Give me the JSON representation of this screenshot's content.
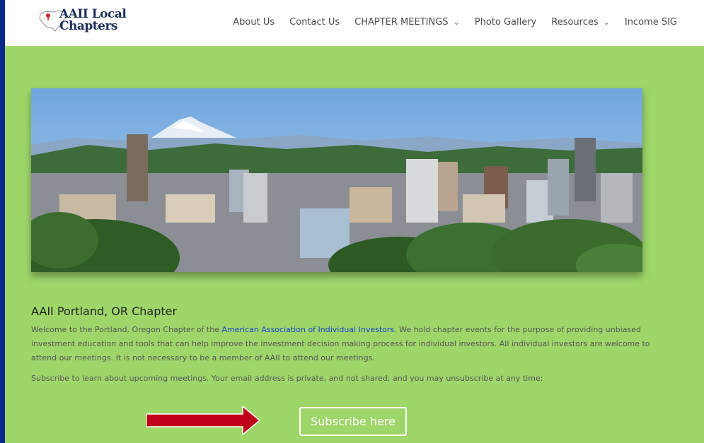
{
  "header": {
    "logo": {
      "line1": "AAII Local",
      "line2": "Chapters"
    },
    "nav": [
      {
        "label": "About Us",
        "dropdown": false
      },
      {
        "label": "Contact Us",
        "dropdown": false
      },
      {
        "label": "CHAPTER MEETINGS",
        "dropdown": true
      },
      {
        "label": "Photo Gallery",
        "dropdown": false
      },
      {
        "label": "Resources",
        "dropdown": true
      },
      {
        "label": "Income SIG",
        "dropdown": false
      }
    ],
    "chevron": "⌄"
  },
  "main": {
    "title": "AAII Portland, OR Chapter",
    "intro_before": "Welcome to the Portland, Oregon Chapter of the ",
    "intro_link": "American Association of Individual Investors",
    "intro_after": ". We hold chapter events for the purpose of providing unbiased investment education and tools that can help improve the investment decision making process for individual investors. All individual investors are welcome to attend our meetings. It is not necessary to be a member of AAII to attend our meetings.",
    "subscribe_note": "Subscribe to learn about upcoming meetings. Your email address is private, and not shared; and you may unsubscribe at any time:",
    "subscribe_button": "Subscribe here"
  },
  "colors": {
    "page_bg": "#9ed66a",
    "frame": "#0a2a8a",
    "link": "#1744c8",
    "arrow": "#c0001a"
  }
}
